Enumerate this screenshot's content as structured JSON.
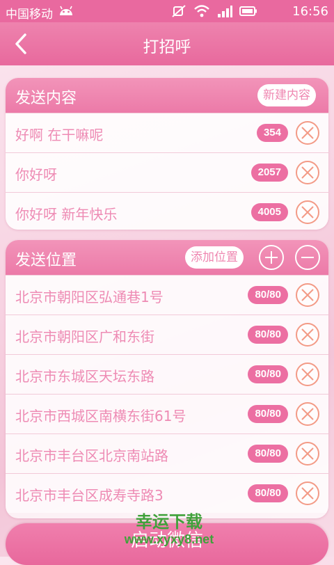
{
  "status_bar": {
    "carrier": "中国移动",
    "time": "16:56",
    "icons": [
      "android-icon",
      "mute-icon",
      "wifi-icon",
      "signal-icon",
      "battery-icon"
    ]
  },
  "header": {
    "title": "打招呼",
    "back_icon": "chevron-left-icon"
  },
  "content_section": {
    "title": "发送内容",
    "new_button": "新建内容",
    "items": [
      {
        "text": "好啊 在干嘛呢",
        "count": "354"
      },
      {
        "text": "你好呀",
        "count": "2057"
      },
      {
        "text": "你好呀 新年快乐",
        "count": "4005"
      }
    ]
  },
  "location_section": {
    "title": "发送位置",
    "add_button": "添加位置",
    "items": [
      {
        "text": "北京市朝阳区弘通巷1号",
        "count": "80/80"
      },
      {
        "text": "北京市朝阳区广和东街",
        "count": "80/80"
      },
      {
        "text": "北京市东城区天坛东路",
        "count": "80/80"
      },
      {
        "text": "北京市西城区南横东街61号",
        "count": "80/80"
      },
      {
        "text": "北京市丰台区北京南站路",
        "count": "80/80"
      },
      {
        "text": "北京市丰台区成寿寺路3",
        "count": "80/80"
      }
    ]
  },
  "footer": {
    "start_button": "启动微信"
  },
  "watermark": {
    "line1": "幸运下载",
    "line2": "www.xyxy8.net"
  },
  "colors": {
    "accent": "#e9699f",
    "text_pink": "#ee8bb4",
    "delete_orange": "#f39a86"
  }
}
